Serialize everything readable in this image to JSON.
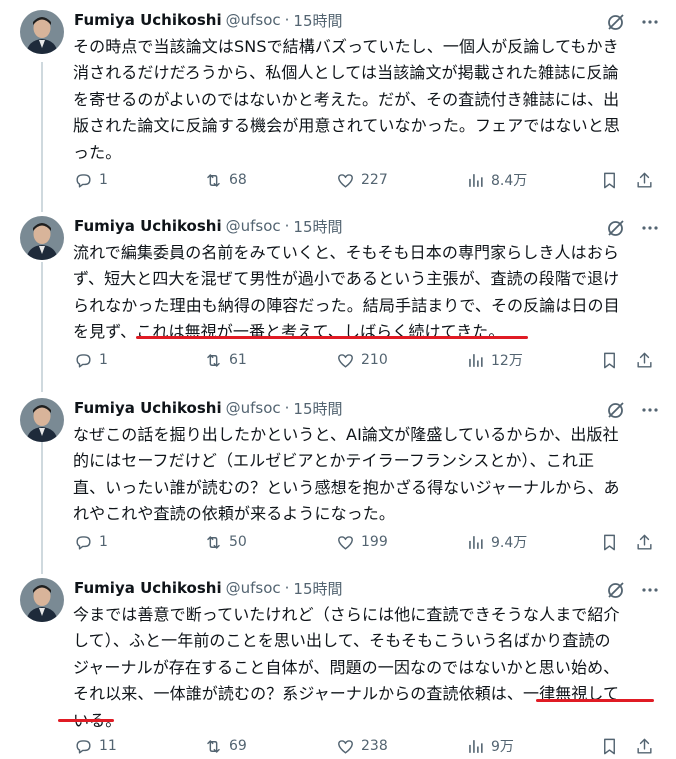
{
  "tweets": [
    {
      "name": "Fumiya Uchikoshi",
      "handle": "@ufsoc",
      "time": "15時間",
      "lines": [
        "その時点で当該論文はSNSで結構バズっていたし、一個人が反論してもかき",
        "消されるだけだろうから、私個人としては当該論文が掲載された雑誌に反論",
        "を寄せるのがよいのではないかと考えた。だが、その査読付き雑誌には、出",
        "版された論文に反論する機会が用意されていなかった。フェアではないと思",
        "った。"
      ],
      "replies": "1",
      "retweets": "68",
      "likes": "227",
      "views": "8.4万"
    },
    {
      "name": "Fumiya Uchikoshi",
      "handle": "@ufsoc",
      "time": "15時間",
      "lines": [
        "流れで編集委員の名前をみていくと、そもそも日本の専門家らしき人はおら",
        "ず、短大と四大を混ぜて男性が過小であるという主張が、査読の段階で退け",
        "られなかった理由も納得の陣容だった。結局手詰まりで、その反論は日の目",
        "を見ず、これは無視が一番と考えて、しばらく続けてきた。"
      ],
      "replies": "1",
      "retweets": "61",
      "likes": "210",
      "views": "12万"
    },
    {
      "name": "Fumiya Uchikoshi",
      "handle": "@ufsoc",
      "time": "15時間",
      "lines": [
        "なぜこの話を掘り出したかというと、AI論文が隆盛しているからか、出版社",
        "的にはセーフだけど（エルゼビアとかテイラーフランシスとか）、これ正",
        "直、いったい誰が読むの？という感想を抱かざる得ないジャーナルから、あ",
        "れやこれや査読の依頼が来るようになった。"
      ],
      "replies": "1",
      "retweets": "50",
      "likes": "199",
      "views": "9.4万"
    },
    {
      "name": "Fumiya Uchikoshi",
      "handle": "@ufsoc",
      "time": "15時間",
      "lines": [
        "今までは善意で断っていたけれど（さらには他に査読できそうな人まで紹介",
        "して）、ふと一年前のことを思い出して、そもそもこういう名ばかり査読の",
        "ジャーナルが存在すること自体が、問題の一因なのではないかと思い始め、",
        "それ以来、一体誰が読むの？系ジャーナルからの査読依頼は、一律無視して",
        "いる。"
      ],
      "replies": "11",
      "retweets": "69",
      "likes": "238",
      "views": "9万"
    }
  ],
  "icons": {
    "grok": "grok-slash-icon",
    "more": "more-dots-icon",
    "reply": "reply-bubble-icon",
    "retweet": "retweet-icon",
    "like": "heart-icon",
    "views": "views-bar-chart-icon",
    "bookmark": "bookmark-icon",
    "share": "share-icon"
  },
  "colors": {
    "text": "#0f1419",
    "muted": "#536471",
    "thread": "#cfd9de",
    "highlight": "#e01b24"
  }
}
